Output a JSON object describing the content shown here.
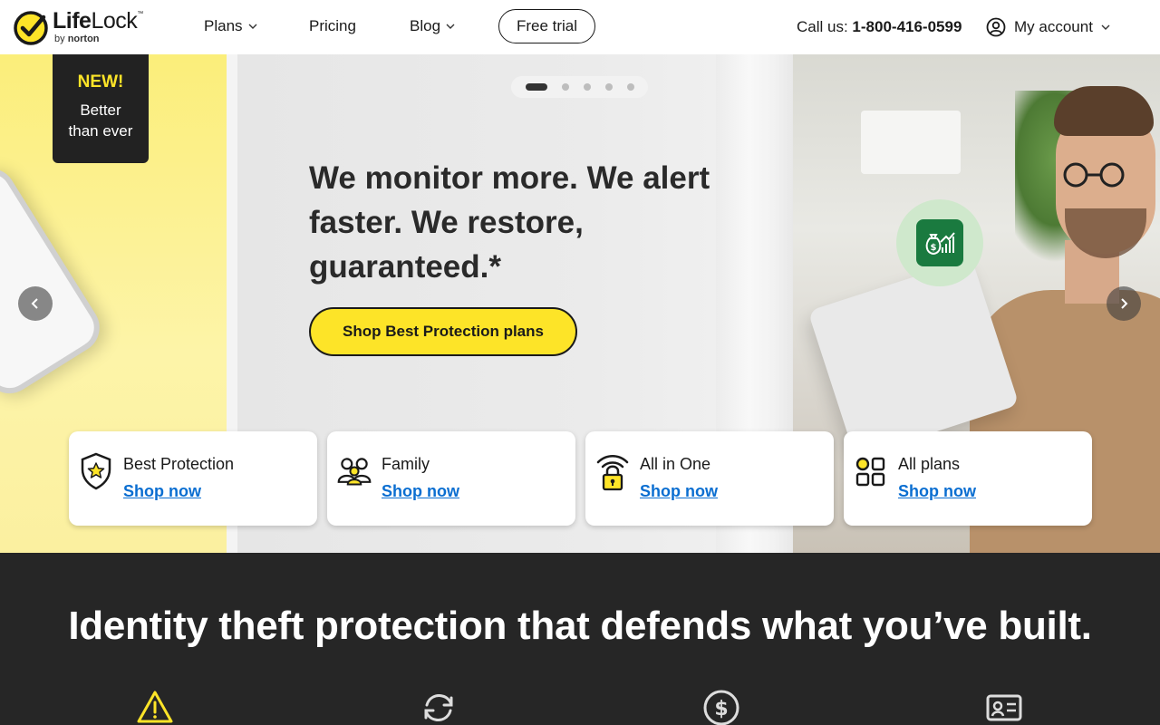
{
  "brand": {
    "name_part1": "Life",
    "name_part2": "Lock",
    "trademark": "™",
    "by": "by",
    "parent": "norton",
    "accent": "#fde428"
  },
  "nav": {
    "plans": "Plans",
    "pricing": "Pricing",
    "blog": "Blog",
    "free_trial": "Free trial",
    "call_label": "Call us:",
    "phone": "1-800-416-0599",
    "account": "My account"
  },
  "hero": {
    "badge_new": "NEW!",
    "badge_line1": "Better",
    "badge_line2": "than ever",
    "headline": "We monitor more. We alert faster. We restore, guaranteed.*",
    "cta": "Shop Best Protection plans",
    "carousel": {
      "slides": 5,
      "active": 1
    }
  },
  "plans": [
    {
      "title": "Best Protection",
      "link": "Shop now",
      "icon": "shield-star-icon"
    },
    {
      "title": "Family",
      "link": "Shop now",
      "icon": "family-icon"
    },
    {
      "title": "All in One",
      "link": "Shop now",
      "icon": "wifi-lock-icon"
    },
    {
      "title": "All plans",
      "link": "Shop now",
      "icon": "grid-icon"
    }
  ],
  "section": {
    "title": "Identity theft protection that defends what you’ve built.",
    "icons": [
      "warning-icon",
      "refresh-icon",
      "dollar-icon",
      "id-card-icon"
    ]
  },
  "colors": {
    "link": "#0a6ed1",
    "dark_bg": "#262626",
    "money_green": "#1a7a3f"
  }
}
